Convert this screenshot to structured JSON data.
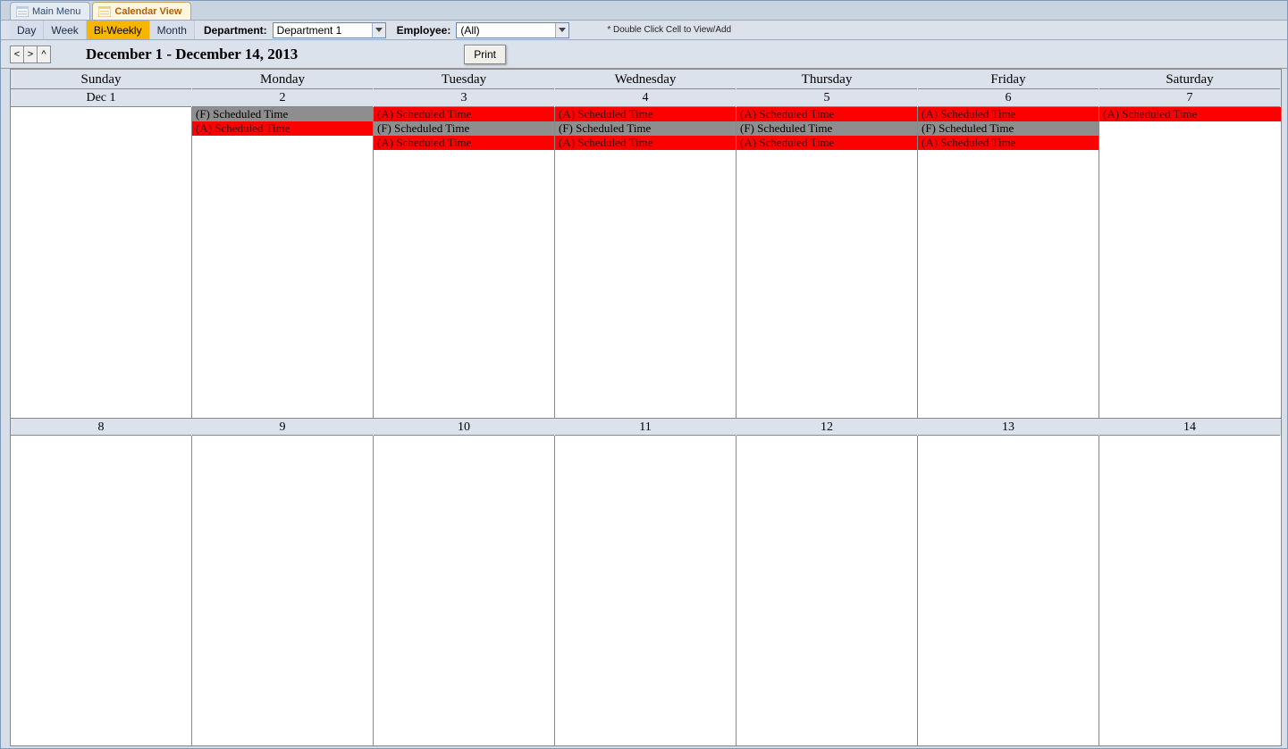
{
  "tabs": [
    {
      "label": "Main Menu",
      "active": false
    },
    {
      "label": "Calendar View",
      "active": true
    }
  ],
  "toolbar": {
    "views": {
      "day": "Day",
      "week": "Week",
      "biweekly": "Bi-Weekly",
      "month": "Month",
      "selected": "biweekly"
    },
    "department_label": "Department:",
    "department_value": "Department 1",
    "employee_label": "Employee:",
    "employee_value": "(All)",
    "hint": "* Double Click Cell to View/Add"
  },
  "nav": {
    "prev": "<",
    "next": ">",
    "up": "^",
    "range_title": "December 1 - December 14, 2013",
    "print": "Print"
  },
  "day_headers": [
    "Sunday",
    "Monday",
    "Tuesday",
    "Wednesday",
    "Thursday",
    "Friday",
    "Saturday"
  ],
  "weeks": [
    {
      "dates": [
        "Dec 1",
        "2",
        "3",
        "4",
        "5",
        "6",
        "7"
      ],
      "events": [
        [],
        [
          {
            "label": "(F) Scheduled Time",
            "color": "gray"
          },
          {
            "label": "(A) Scheduled Time",
            "color": "red"
          }
        ],
        [
          {
            "label": "(A) Scheduled Time",
            "color": "red"
          },
          {
            "label": "(F) Scheduled Time",
            "color": "gray"
          },
          {
            "label": "(A) Scheduled Time",
            "color": "red"
          }
        ],
        [
          {
            "label": "(A) Scheduled Time",
            "color": "red"
          },
          {
            "label": "(F) Scheduled Time",
            "color": "gray"
          },
          {
            "label": "(A) Scheduled Time",
            "color": "red"
          }
        ],
        [
          {
            "label": "(A) Scheduled Time",
            "color": "red"
          },
          {
            "label": "(F) Scheduled Time",
            "color": "gray"
          },
          {
            "label": "(A) Scheduled Time",
            "color": "red"
          }
        ],
        [
          {
            "label": "(A) Scheduled Time",
            "color": "red"
          },
          {
            "label": "(F) Scheduled Time",
            "color": "gray"
          },
          {
            "label": "(A) Scheduled Time",
            "color": "red"
          }
        ],
        [
          {
            "label": "(A) Scheduled Time",
            "color": "red"
          }
        ]
      ]
    },
    {
      "dates": [
        "8",
        "9",
        "10",
        "11",
        "12",
        "13",
        "14"
      ],
      "events": [
        [],
        [],
        [],
        [],
        [],
        [],
        []
      ]
    }
  ]
}
